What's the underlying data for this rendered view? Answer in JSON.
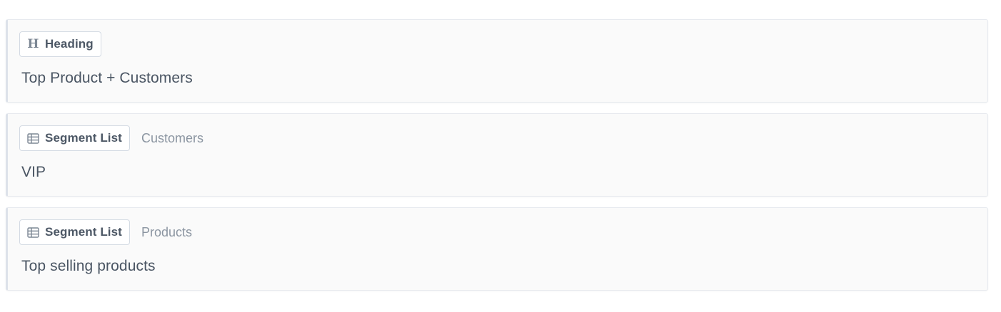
{
  "blocks": [
    {
      "type_label": "Heading",
      "type_icon": "heading-icon",
      "context": "",
      "title": "Top Product + Customers"
    },
    {
      "type_label": "Segment List",
      "type_icon": "table-icon",
      "context": "Customers",
      "title": "VIP"
    },
    {
      "type_label": "Segment List",
      "type_icon": "table-icon",
      "context": "Products",
      "title": "Top selling products"
    }
  ],
  "colors": {
    "card_background": "#fafafa",
    "card_border": "#e6e9ee",
    "badge_border": "#d3dae3",
    "text_primary": "#4a5563",
    "text_muted": "#8b95a1"
  }
}
